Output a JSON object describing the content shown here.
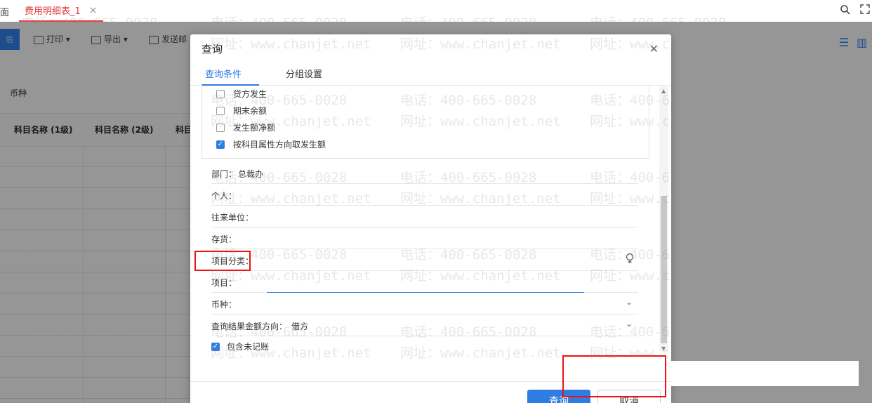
{
  "tabs": {
    "prev_label": "面",
    "active_label": "费用明细表_1",
    "close_glyph": "×"
  },
  "top_icons": {
    "search": "search-icon",
    "fullscreen": "fullscreen-icon"
  },
  "toolbar": {
    "print_label": "打印",
    "export_label": "导出",
    "send_label": "发送邮"
  },
  "background": {
    "currency_label": "币种",
    "grid_headers": [
      "科目名称 (1级)",
      "科目名称 (2级)",
      "科目"
    ]
  },
  "dialog": {
    "title": "查询",
    "tabs": [
      "查询条件",
      "分组设置"
    ],
    "checkboxes": [
      {
        "label": "贷方发生",
        "checked": false
      },
      {
        "label": "期末余额",
        "checked": false
      },
      {
        "label": "发生额净额",
        "checked": false
      },
      {
        "label": "按科目属性方向取发生额",
        "checked": true
      }
    ],
    "fields": {
      "department": {
        "label": "部门：",
        "value": "总裁办"
      },
      "person": {
        "label": "个人："
      },
      "partner": {
        "label": "往来单位："
      },
      "inventory": {
        "label": "存货："
      },
      "project_category": {
        "label": "项目分类："
      },
      "project": {
        "label": "项目："
      },
      "currency": {
        "label": "币种："
      },
      "direction": {
        "label": "查询结果金额方向：",
        "value": "借方"
      }
    },
    "include_unposted": {
      "label": "包含未记账",
      "checked": true
    },
    "query_button": "查询",
    "cancel_button": "取消"
  },
  "watermark": {
    "phone": "电话：400-665-0028",
    "site": "网址：www.chanjet.net"
  },
  "colors": {
    "accent": "#2f7de1",
    "tab_active": "#e33d3d",
    "highlight_box": "#ee1111"
  }
}
